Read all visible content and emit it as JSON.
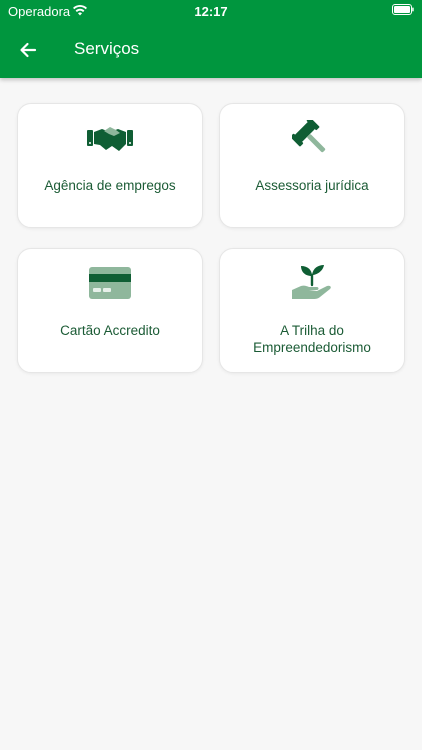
{
  "status_bar": {
    "carrier": "Operadora",
    "time": "12:17"
  },
  "header": {
    "title": "Serviços",
    "background": "#00963e"
  },
  "services": [
    {
      "label": "Agência de empregos",
      "icon": "handshake-icon"
    },
    {
      "label": "Assessoria jurídica",
      "icon": "gavel-icon"
    },
    {
      "label": "Cartão Accredito",
      "icon": "credit-card-icon"
    },
    {
      "label": "A Trilha do Empreendedorismo",
      "icon": "plant-hand-icon"
    }
  ],
  "colors": {
    "primary": "#00963e",
    "dark_green": "#1b5b35",
    "icon_dark": "#0f5e34",
    "icon_light": "#8fb79c"
  }
}
